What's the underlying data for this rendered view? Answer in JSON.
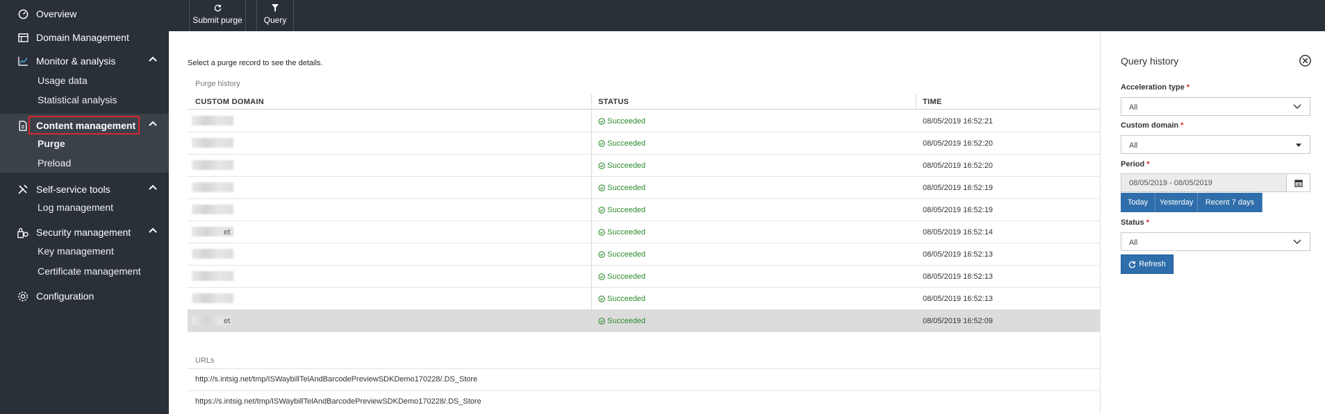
{
  "sidebar": {
    "items": [
      {
        "label": "Overview",
        "icon": "overview-icon"
      },
      {
        "label": "Domain Management",
        "icon": "domain-icon"
      },
      {
        "label": "Monitor & analysis",
        "icon": "monitor-icon"
      },
      {
        "label": "Content management",
        "icon": "content-icon"
      },
      {
        "label": "Self-service tools",
        "icon": "tools-icon"
      },
      {
        "label": "Security management",
        "icon": "security-icon"
      },
      {
        "label": "Configuration",
        "icon": "gear-icon"
      }
    ],
    "monitor_sub": [
      "Usage data",
      "Statistical analysis"
    ],
    "content_sub": [
      "Purge",
      "Preload"
    ],
    "tools_sub": [
      "Log management"
    ],
    "security_sub": [
      "Key management",
      "Certificate management"
    ]
  },
  "toolbar": {
    "submit_label": "Submit purge",
    "query_label": "Query"
  },
  "main": {
    "hint": "Select a purge record to see the details.",
    "purge_history_title": "Purge history",
    "columns": [
      "CUSTOM DOMAIN",
      "STATUS",
      "TIME"
    ],
    "rows": [
      {
        "domain_suffix": "",
        "status": "Succeeded",
        "time": "08/05/2019 16:52:21"
      },
      {
        "domain_suffix": "",
        "status": "Succeeded",
        "time": "08/05/2019 16:52:20"
      },
      {
        "domain_suffix": "",
        "status": "Succeeded",
        "time": "08/05/2019 16:52:20"
      },
      {
        "domain_suffix": "",
        "status": "Succeeded",
        "time": "08/05/2019 16:52:19"
      },
      {
        "domain_suffix": "",
        "status": "Succeeded",
        "time": "08/05/2019 16:52:19"
      },
      {
        "domain_suffix": "et",
        "status": "Succeeded",
        "time": "08/05/2019 16:52:14"
      },
      {
        "domain_suffix": "",
        "status": "Succeeded",
        "time": "08/05/2019 16:52:13"
      },
      {
        "domain_suffix": "",
        "status": "Succeeded",
        "time": "08/05/2019 16:52:13"
      },
      {
        "domain_suffix": "",
        "status": "Succeeded",
        "time": "08/05/2019 16:52:13"
      },
      {
        "domain_suffix": "et",
        "status": "Succeeded",
        "time": "08/05/2019 16:52:09"
      }
    ],
    "urls_title": "URLs",
    "urls": [
      "http://s.intsig.net/tmp/ISWaybillTelAndBarcodePreviewSDKDemo170228/.DS_Store",
      "https://s.intsig.net/tmp/ISWaybillTelAndBarcodePreviewSDKDemo170228/.DS_Store"
    ]
  },
  "panel": {
    "title": "Query history",
    "acceleration_label": "Acceleration type",
    "acceleration_value": "All",
    "domain_label": "Custom domain",
    "domain_value": "All",
    "period_label": "Period",
    "period_value": "08/05/2019 - 08/05/2019",
    "quick": [
      "Today",
      "Yesterday",
      "Recent 7 days"
    ],
    "status_label": "Status",
    "status_value": "All",
    "refresh_label": "Refresh",
    "required_mark": "*"
  },
  "colors": {
    "sidebar_bg": "#2a3038",
    "accent": "#2f6eaa",
    "success": "#2c8a2c",
    "highlight_box": "#d9272e"
  }
}
